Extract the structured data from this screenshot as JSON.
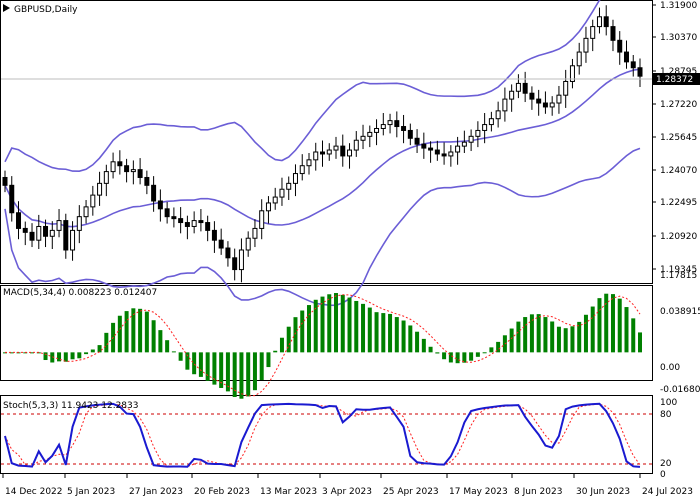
{
  "symbol_title": "GBPUSD,Daily",
  "colors": {
    "background": "#ffffff",
    "bands": "#6b5ed6",
    "candle": "#000000",
    "price_line": "#c0c0c0",
    "macd_hist": "#008000",
    "macd_signal": "#ff2020",
    "stoch_main": "#1a1ad0",
    "stoch_signal": "#ff2020",
    "stoch_levels": "#cc0000",
    "axis_box": "#000000"
  },
  "price_panel": {
    "y_ticks": [
      "1.31900",
      "1.30370",
      "1.28795",
      "1.27220",
      "1.25645",
      "1.24070",
      "1.22495",
      "1.20920",
      "1.19345",
      "1.17815"
    ],
    "current_price": "1.28372"
  },
  "macd_panel": {
    "title": "MACD(5,34,4) 0.008223 0.012407",
    "y_ticks": [
      "0.038915",
      "0.00",
      "-0.016808"
    ]
  },
  "stoch_panel": {
    "title": "Stoch(5,3,3) 11.9423 12.2833",
    "y_ticks": [
      "100",
      "80",
      "20",
      "0"
    ]
  },
  "x_axis": {
    "labels": [
      "14 Dec 2022",
      "5 Jan 2023",
      "27 Jan 2023",
      "20 Feb 2023",
      "13 Mar 2023",
      "3 Apr 2023",
      "25 Apr 2023",
      "17 May 2023",
      "8 Jun 2023",
      "30 Jun 2023",
      "24 Jul 2023"
    ]
  },
  "chart_data": {
    "type": "candlestick",
    "symbol": "GBPUSD",
    "timeframe": "Daily",
    "ylim": [
      1.17815,
      1.319
    ],
    "close_path": [
      1.228,
      1.214,
      1.206,
      1.204,
      1.2,
      1.207,
      1.202,
      1.205,
      1.21,
      1.195,
      1.205,
      1.212,
      1.217,
      1.223,
      1.229,
      1.235,
      1.24,
      1.238,
      1.235,
      1.236,
      1.232,
      1.228,
      1.22,
      1.216,
      1.212,
      1.211,
      1.209,
      1.207,
      1.21,
      1.209,
      1.205,
      1.2,
      1.196,
      1.191,
      1.185,
      1.195,
      1.201,
      1.206,
      1.215,
      1.219,
      1.222,
      1.226,
      1.229,
      1.234,
      1.238,
      1.241,
      1.245,
      1.244,
      1.246,
      1.248,
      1.243,
      1.246,
      1.251,
      1.253,
      1.255,
      1.257,
      1.259,
      1.261,
      1.258,
      1.256,
      1.252,
      1.249,
      1.247,
      1.246,
      1.244,
      1.243,
      1.245,
      1.248,
      1.25,
      1.253,
      1.256,
      1.259,
      1.262,
      1.266,
      1.272,
      1.276,
      1.28,
      1.275,
      1.272,
      1.27,
      1.268,
      1.27,
      1.274,
      1.281,
      1.289,
      1.296,
      1.303,
      1.309,
      1.314,
      1.309,
      1.302,
      1.296,
      1.291,
      1.288,
      1.2837
    ],
    "bollinger": {
      "upper": "upper band",
      "middle": "middle band",
      "lower": "lower band"
    },
    "macd": {
      "params": "5,34,4",
      "main": 0.008223,
      "signal": 0.012407,
      "ylim": [
        -0.016808,
        0.038915
      ]
    },
    "stochastic": {
      "params": "5,3,3",
      "main": 11.9423,
      "signal": 12.2833,
      "levels": [
        20,
        80
      ],
      "ylim": [
        0,
        100
      ]
    }
  }
}
